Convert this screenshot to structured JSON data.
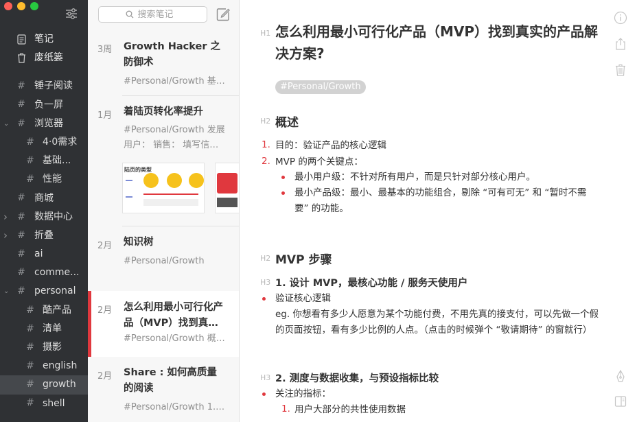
{
  "sidebar": {
    "items": [
      {
        "label": "笔记",
        "icon": "note-icon",
        "level": 0
      },
      {
        "label": "废纸篓",
        "icon": "trash-icon",
        "level": 0
      },
      {
        "label": "锤子阅读",
        "icon": "hash-icon",
        "level": 0
      },
      {
        "label": "负一屏",
        "icon": "hash-icon",
        "level": 0
      },
      {
        "label": "浏览器",
        "icon": "hash-icon",
        "level": 0,
        "chevron": "down"
      },
      {
        "label": "4·0需求",
        "icon": "hash-icon",
        "level": 1
      },
      {
        "label": "基础...",
        "icon": "hash-icon",
        "level": 1
      },
      {
        "label": "性能",
        "icon": "hash-icon",
        "level": 1
      },
      {
        "label": "商城",
        "icon": "hash-icon",
        "level": 0
      },
      {
        "label": "数据中心",
        "icon": "hash-icon",
        "level": 0,
        "chevron": "right"
      },
      {
        "label": "折叠",
        "icon": "hash-icon",
        "level": 0,
        "chevron": "right"
      },
      {
        "label": "ai",
        "icon": "hash-icon",
        "level": 0
      },
      {
        "label": "comme...",
        "icon": "hash-icon",
        "level": 0
      },
      {
        "label": "personal",
        "icon": "hash-icon",
        "level": 0,
        "chevron": "down"
      },
      {
        "label": "酷产品",
        "icon": "hash-icon",
        "level": 1
      },
      {
        "label": "清单",
        "icon": "hash-icon",
        "level": 1
      },
      {
        "label": "摄影",
        "icon": "hash-icon",
        "level": 1
      },
      {
        "label": "english",
        "icon": "hash-icon",
        "level": 1
      },
      {
        "label": "growth",
        "icon": "hash-icon",
        "level": 1,
        "selected": true
      },
      {
        "label": "shell",
        "icon": "hash-icon",
        "level": 1
      }
    ]
  },
  "notelist": {
    "search_placeholder": "搜索笔记",
    "notes": [
      {
        "date": "3周",
        "title": "Growth Hacker 之防御术",
        "snippet": "#Personal/Growth 基…"
      },
      {
        "date": "1月",
        "title": "着陆页转化率提升",
        "snippet": "#Personal/Growth 发展 用户： 销售： 填写信…",
        "thumb_title": "陆页的类型"
      },
      {
        "date": "2月",
        "title": "知识树",
        "snippet": "#Personal/Growth"
      },
      {
        "date": "2月",
        "title": "怎么利用最小可行化产品（MVP）找到真…",
        "snippet": "#Personal/Growth 概…",
        "active": true
      },
      {
        "date": "2月",
        "title": "Share : 如何高质量的阅读",
        "snippet": "#Personal/Growth 1.…"
      }
    ]
  },
  "editor": {
    "h1_marker": "H1",
    "h2_marker": "H2",
    "h3_marker": "H3",
    "title": "怎么利用最小可行化产品（MVP）找到真实的产品解决方案?",
    "tag": "#Personal/Growth",
    "section1": {
      "heading": "概述",
      "items": [
        {
          "num": "1.",
          "text": "目的：验证产品的核心逻辑"
        },
        {
          "num": "2.",
          "text": "MVP 的两个关键点："
        }
      ],
      "bullets": [
        "最小用户级：不针对所有用户，而是只针对部分核心用户。",
        "最小产品级：最小、最基本的功能组合，剔除 “可有可无” 和 “暂时不需要” 的功能。"
      ]
    },
    "section2": {
      "heading": "MVP 步骤",
      "step1": {
        "heading": "1. 设计 MVP，最核心功能 / 服务天使用户",
        "bullet": "验证核心逻辑",
        "para": "eg. 你想看有多少人愿意为某个功能付费，不用先真的接支付，可以先做一个假的页面按钮，看有多少比例的人点。（点击的时候弹个 “敬请期待” 的窗就行）"
      },
      "step2": {
        "heading": "2. 测度与数据收集，与预设指标比较",
        "bullet": "关注的指标：",
        "items": [
          {
            "num": "1.",
            "text": "用户大部分的共性使用数据"
          }
        ]
      }
    }
  }
}
